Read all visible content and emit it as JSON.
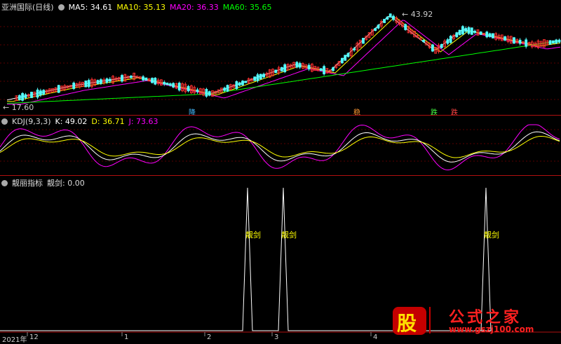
{
  "main": {
    "title": "亚洲国际(日线)",
    "ma5": "MA5: 34.61",
    "ma10": "MA10: 35.13",
    "ma20": "MA20: 36.33",
    "ma60": "MA60: 35.65",
    "high_label": "43.92",
    "low_label": "17.60",
    "tags": [
      "降",
      "稳",
      "跌",
      "跌"
    ]
  },
  "kdj": {
    "title": "KDJ(9,3,3)",
    "k": "K: 49.02",
    "d": "D: 36.71",
    "j": "J: 73.63"
  },
  "indicator": {
    "title": "靓丽指标",
    "value": "靓剑: 0.00",
    "signal_label": "靓剑"
  },
  "axis": {
    "labels": [
      "2021年",
      "12",
      "1",
      "2",
      "3",
      "4"
    ]
  },
  "watermark": {
    "glyph": "股",
    "text": "公式之家",
    "url": "www.gszj100.com"
  },
  "colors": {
    "ma5": "#ffffff",
    "ma10": "#ffff00",
    "ma20": "#ff00ff",
    "ma60": "#00ff00",
    "k": "#ffffff",
    "d": "#ffff00",
    "j": "#ff00ff"
  }
}
